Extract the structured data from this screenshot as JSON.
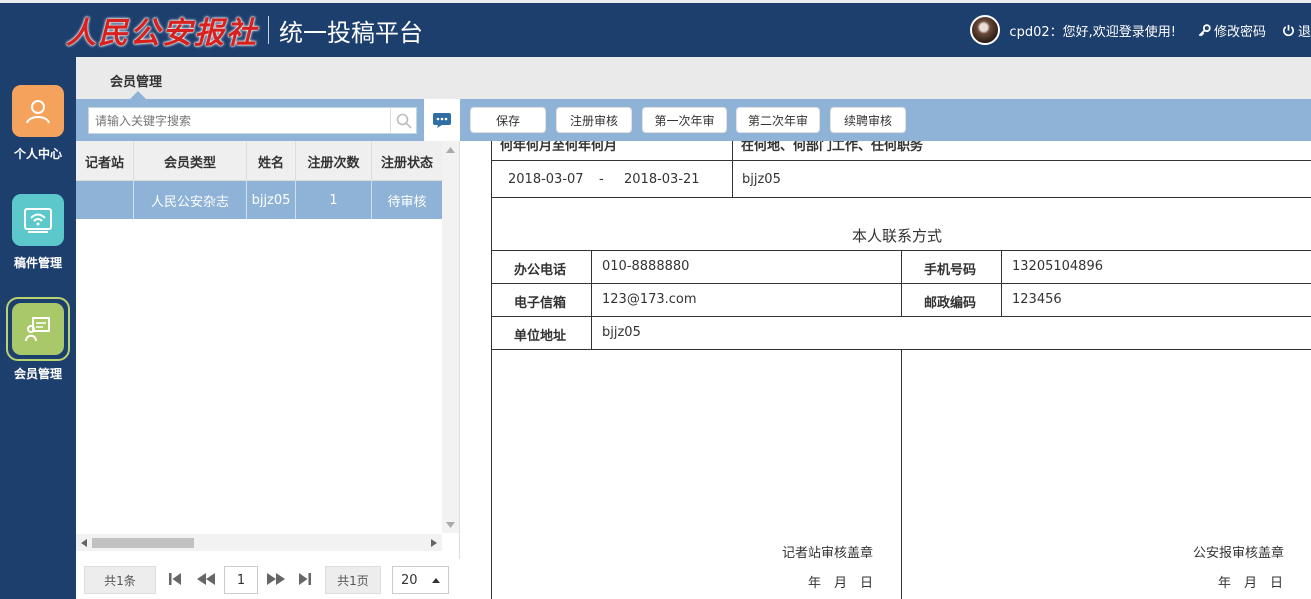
{
  "header": {
    "logo_text": "人民公安报社",
    "platform_title": "统一投稿平台",
    "user_greeting": "cpd02：您好,欢迎登录使用!",
    "change_password": "修改密码",
    "logout": "退"
  },
  "nav": {
    "items": [
      {
        "label": "个人中心",
        "icon": "person-icon",
        "color": "#f5a25d"
      },
      {
        "label": "稿件管理",
        "icon": "wifi-screen-icon",
        "color": "#5cc8cc"
      },
      {
        "label": "会员管理",
        "icon": "member-board-icon",
        "color": "#a8c86a"
      }
    ]
  },
  "module_tab": "会员管理",
  "search": {
    "placeholder": "请输入关键字搜索"
  },
  "toolbar": {
    "save": "保存",
    "register_review": "注册审核",
    "first_annual": "第一次年审",
    "second_annual": "第二次年审",
    "renew_review": "续聘审核"
  },
  "grid": {
    "columns": [
      "记者站",
      "会员类型",
      "姓名",
      "注册次数",
      "注册状态"
    ],
    "rows": [
      [
        "",
        "人民公安杂志",
        "bjjz05",
        "1",
        "待审核"
      ]
    ]
  },
  "pager": {
    "total_records": "共1条",
    "current_page": "1",
    "total_pages": "共1页",
    "page_size": "20"
  },
  "form": {
    "cut_header_left": "何年何月至何年何月",
    "cut_header_right": "在何地、何部门工作、任何职务",
    "period_start": "2018-03-07",
    "period_dash": "-",
    "period_end": "2018-03-21",
    "work_place": "bjjz05",
    "section_title": "本人联系方式",
    "office_phone_label": "办公电话",
    "office_phone": "010-8888880",
    "mobile_label": "手机号码",
    "mobile": "13205104896",
    "email_label": "电子信箱",
    "email": "123@173.com",
    "postcode_label": "邮政编码",
    "postcode": "123456",
    "address_label": "单位地址",
    "address": "bjjz05",
    "stamp_left": "记者站审核盖章",
    "stamp_right": "公安报审核盖章",
    "date_left": "年　月　日",
    "date_right": "年　月　日"
  }
}
